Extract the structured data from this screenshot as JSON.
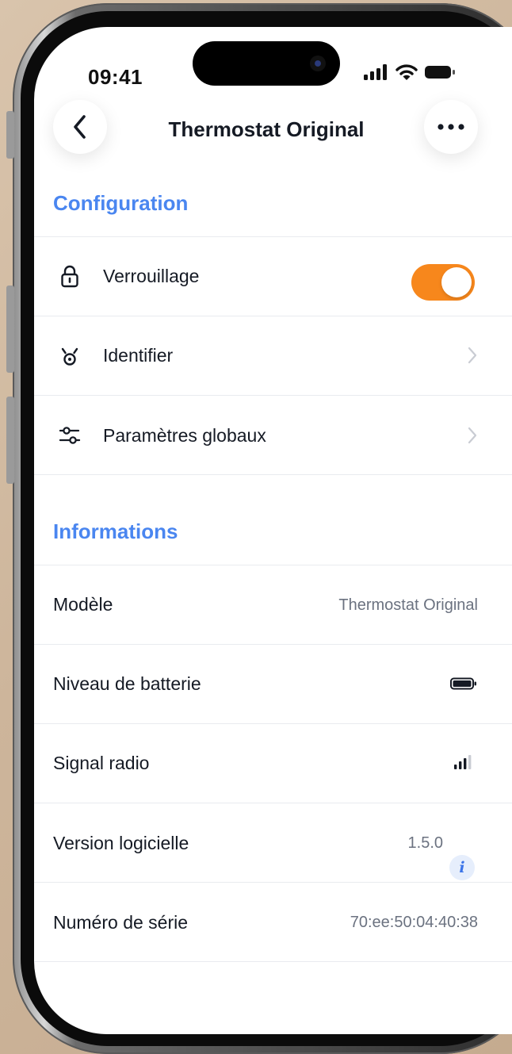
{
  "status_bar": {
    "time": "09:41",
    "icons": [
      "cellular-signal-icon",
      "wifi-icon",
      "battery-icon"
    ]
  },
  "header": {
    "title": "Thermostat Original",
    "back_icon": "chevron-left-icon",
    "more_icon": "more-horizontal-icon"
  },
  "configuration": {
    "title": "Configuration",
    "items": [
      {
        "label": "Verrouillage",
        "icon": "lock-icon",
        "control": "toggle",
        "toggle_on": true
      },
      {
        "label": "Identifier",
        "icon": "identify-blink-icon",
        "control": "chevron"
      },
      {
        "label": "Paramètres globaux",
        "icon": "sliders-icon",
        "control": "chevron"
      }
    ]
  },
  "informations": {
    "title": "Informations",
    "rows": [
      {
        "label": "Modèle",
        "value": "Thermostat Original"
      },
      {
        "label": "Niveau de batterie",
        "value_icon": "battery-full-icon"
      },
      {
        "label": "Signal radio",
        "value_icon": "signal-bars-icon",
        "signal_level": 3,
        "signal_max": 4
      },
      {
        "label": "Version logicielle",
        "value": "1.5.0",
        "info_icon": "info-icon",
        "info_symbol": "i"
      },
      {
        "label": "Numéro de série",
        "value": "70:ee:50:04:40:38"
      }
    ]
  },
  "colors": {
    "accent": "#4a86f0",
    "toggle_on": "#f7871c",
    "text_primary": "#151a24",
    "text_secondary": "#6b7280",
    "divider": "#e9ebef"
  }
}
